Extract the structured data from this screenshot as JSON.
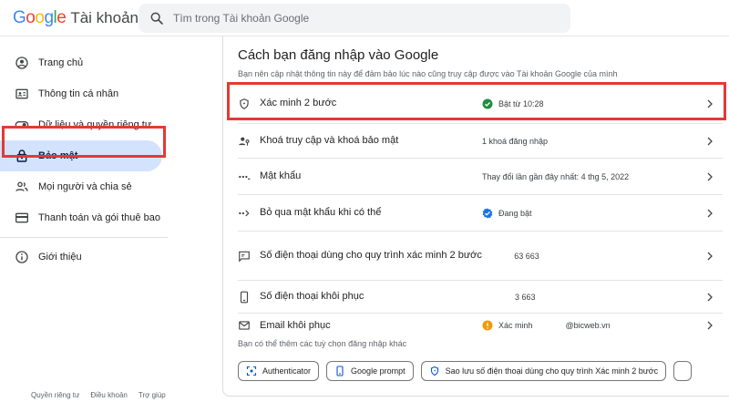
{
  "header": {
    "logo_letters": [
      "G",
      "o",
      "o",
      "g",
      "l",
      "e"
    ],
    "product": "Tài khoản",
    "search_placeholder": "Tìm trong Tài khoản Google"
  },
  "sidebar": {
    "items": [
      {
        "label": "Trang chủ",
        "icon": "home-icon"
      },
      {
        "label": "Thông tin cá nhân",
        "icon": "id-card-icon"
      },
      {
        "label": "Dữ liệu và quyền riêng tư",
        "icon": "toggle-icon"
      },
      {
        "label": "Bảo mật",
        "icon": "lock-icon",
        "active": true
      },
      {
        "label": "Mọi người và chia sẻ",
        "icon": "people-icon"
      },
      {
        "label": "Thanh toán và gói thuê bao",
        "icon": "credit-card-icon"
      }
    ],
    "about": {
      "label": "Giới thiệu",
      "icon": "info-icon"
    }
  },
  "footer": {
    "links": [
      "Quyền riêng tư",
      "Điều khoản",
      "Trợ giúp"
    ]
  },
  "main": {
    "title": "Cách bạn đăng nhập vào Google",
    "description": "Bạn nên cập nhật thông tin này để đảm bảo lúc nào cũng truy cập được vào Tài khoản Google của mình",
    "rows": [
      {
        "label": "Xác minh 2 bước",
        "value": "Bật từ 10:28",
        "icon": "shield-icon",
        "status_icon": "check-circle-icon"
      },
      {
        "label": "Khoá truy cập và khoá bảo mật",
        "value": "1 khoá đăng nhập",
        "icon": "passkey-icon"
      },
      {
        "label": "Mật khẩu",
        "value": "Thay đổi lần gần đây nhất: 4 thg 5, 2022",
        "icon": "password-icon"
      },
      {
        "label": "Bỏ qua mật khẩu khi có thể",
        "value": "Đang bật",
        "icon": "skip-password-icon",
        "status_icon": "verified-icon"
      },
      {
        "label": "Số điện thoại dùng cho quy trình xác minh 2 bước",
        "value": "ﾠ63 663",
        "icon": "message-icon"
      },
      {
        "label": "Số điện thoại khôi phục",
        "value": "3 663",
        "icon": "phone-icon"
      },
      {
        "label": "Email khôi phục",
        "value": "Xác minh",
        "value2": "@bicweb.vn",
        "icon": "mail-icon",
        "status_icon": "warning-icon"
      }
    ],
    "extra_note": "Bạn có thể thêm các tuỳ chọn đăng nhập khác",
    "chips": [
      {
        "label": "Authenticator",
        "icon": "authenticator-icon"
      },
      {
        "label": "Google prompt",
        "icon": "device-icon"
      },
      {
        "label": "Sao lưu số điện thoại dùng cho quy trình Xác minh 2 bước",
        "icon": "shield-icon"
      }
    ]
  },
  "colors": {
    "highlight": "#e53935",
    "active_nav": "#d3e3fd",
    "success": "#1e8e3e",
    "info": "#1a73e8",
    "warning": "#f29900"
  }
}
